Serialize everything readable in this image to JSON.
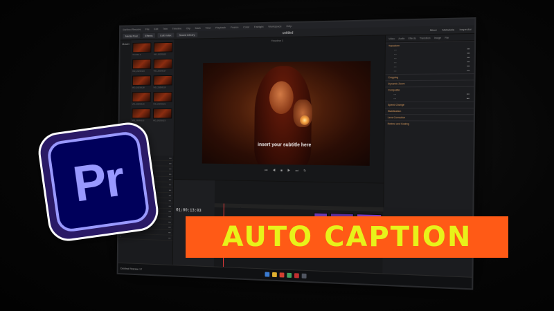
{
  "app": {
    "menu_items": [
      "DaVinci Resolve",
      "File",
      "Edit",
      "Trim",
      "Timeline",
      "Clip",
      "Mark",
      "View",
      "Playback",
      "Fusion",
      "Color",
      "Fairlight",
      "Workspace",
      "Help"
    ],
    "toolbar_buttons": [
      "Media Pool",
      "Effects",
      "Edit Index",
      "Sound Library"
    ],
    "project_title": "untitled",
    "toolbar_right": [
      "Mixer",
      "Metadata",
      "Inspector"
    ],
    "viewer_label": "Timeline 1",
    "timecode": "01:00:13:03",
    "taskbar_label": "DaVinci Resolve 17"
  },
  "media_pool": {
    "side_label": "Master",
    "thumbnails": [
      {
        "label": "Timeline 1"
      },
      {
        "label": "VID_20230115"
      },
      {
        "label": "VID_20230116"
      },
      {
        "label": "VID_20230117"
      },
      {
        "label": "VID_20230118"
      },
      {
        "label": "VID_20230119"
      },
      {
        "label": "VID_20230120"
      },
      {
        "label": "VID_20230121"
      },
      {
        "label": "VID_20230122"
      },
      {
        "label": "VID_20230123"
      }
    ]
  },
  "viewer": {
    "subtitle": "insert your subtitle here",
    "transport": "⏮ ◀ ■ ▶ ⏭ ↻"
  },
  "inspector": {
    "tabs": [
      "Video",
      "Audio",
      "Effects",
      "Transition",
      "Image",
      "File"
    ],
    "sections": [
      "Transform",
      "Cropping",
      "Dynamic Zoom",
      "Composite",
      "Speed Change",
      "Stabilization",
      "Lens Correction",
      "Retime and Scaling"
    ]
  },
  "overlay": {
    "logo_text": "Pr",
    "banner_text": "AUTO CAPTION",
    "colors": {
      "banner_bg": "#ff5a16",
      "banner_text": "#e8f21a",
      "logo_bg": "#00005b",
      "logo_fg": "#9999ff"
    }
  }
}
